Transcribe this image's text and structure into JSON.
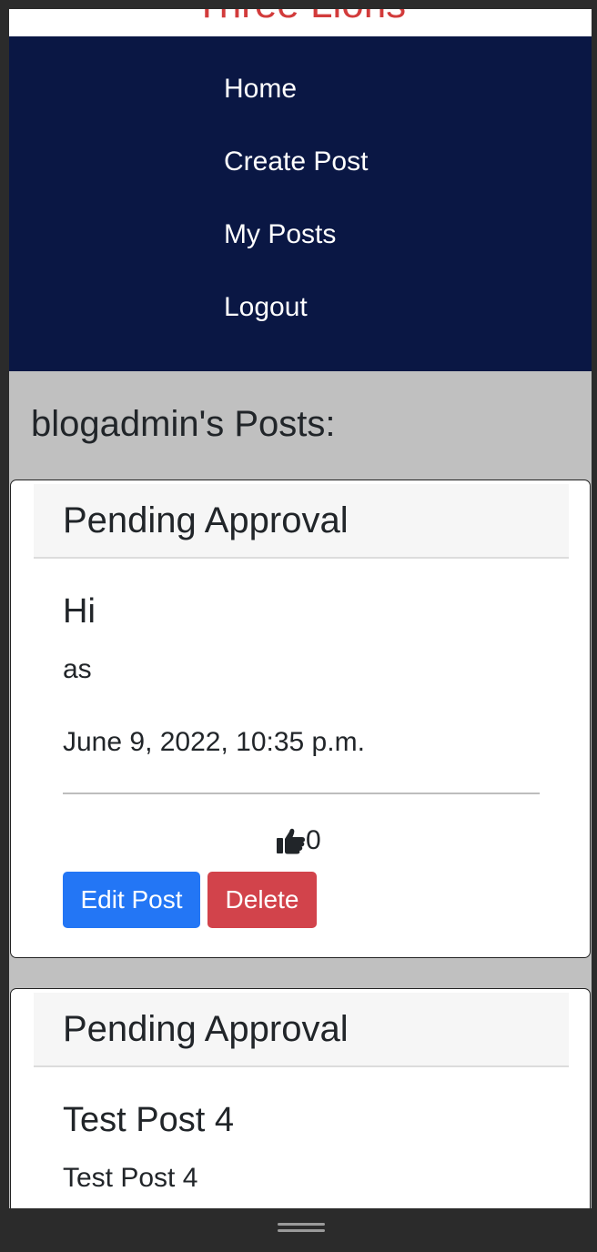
{
  "site": {
    "brand": "Three Lions"
  },
  "nav": {
    "items": [
      {
        "label": "Home"
      },
      {
        "label": "Create Post"
      },
      {
        "label": "My Posts"
      },
      {
        "label": "Logout"
      }
    ]
  },
  "page": {
    "heading": "blogadmin's Posts:"
  },
  "posts": [
    {
      "status": "Pending Approval",
      "title": "Hi",
      "body": "as",
      "date": "June 9, 2022, 10:35 p.m.",
      "likes": "0",
      "edit_label": "Edit Post",
      "delete_label": "Delete"
    },
    {
      "status": "Pending Approval",
      "title": "Test Post 4",
      "body": "Test Post 4"
    }
  ],
  "colors": {
    "navbar": "#0a1744",
    "brand": "#d23b3b",
    "edit_button": "#2376f5",
    "delete_button": "#d2434b",
    "page_background": "#c0c0c0"
  },
  "icons": {
    "like": "thumbs-up-icon",
    "handle": "grab-handle-icon"
  }
}
